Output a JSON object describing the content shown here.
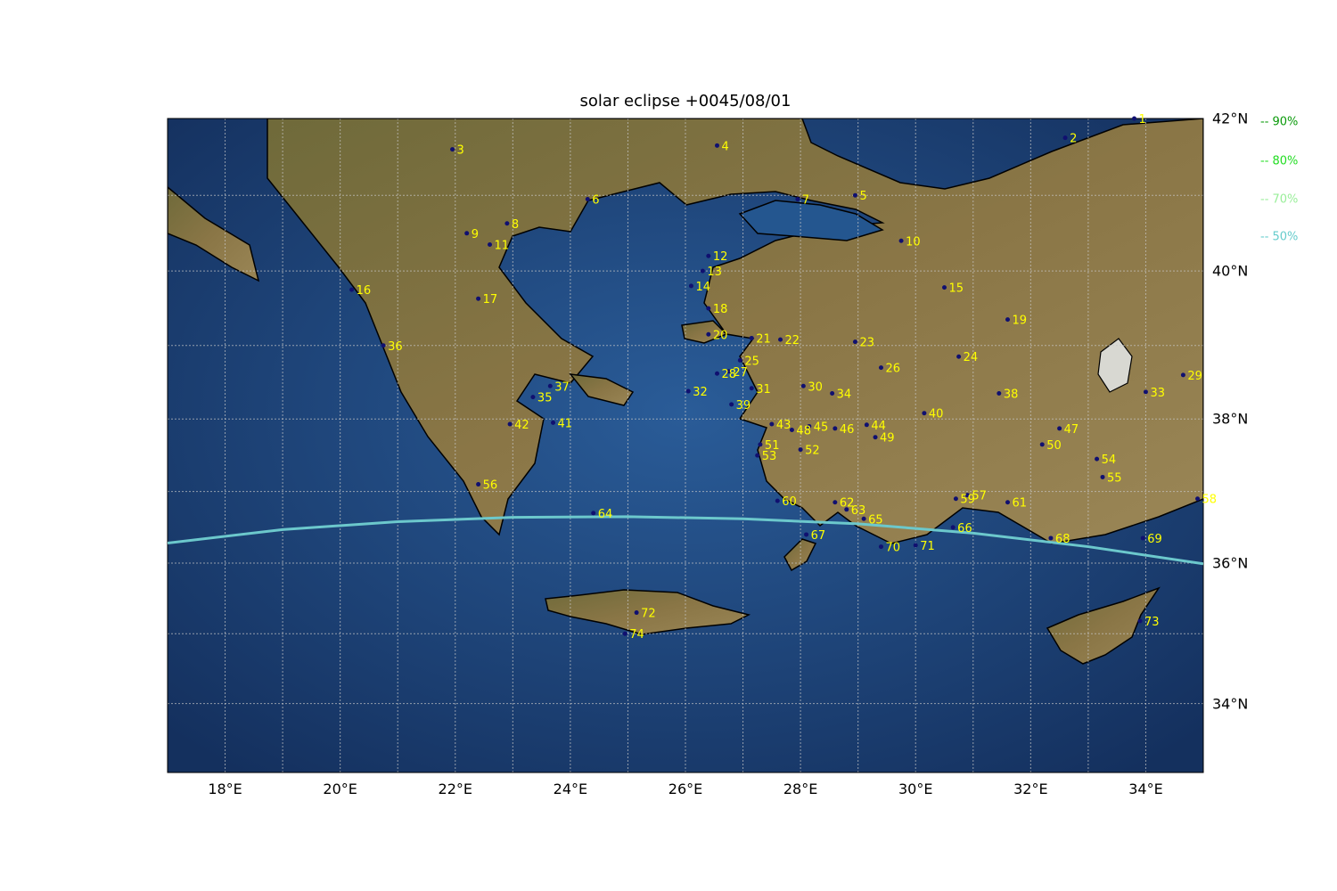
{
  "title": "solar eclipse +0045/08/01",
  "axes": {
    "lon_ticks": [
      "18°E",
      "20°E",
      "22°E",
      "24°E",
      "26°E",
      "28°E",
      "30°E",
      "32°E",
      "34°E"
    ],
    "lat_ticks": [
      "34°N",
      "36°N",
      "38°N",
      "40°N",
      "42°N"
    ]
  },
  "legend": [
    {
      "label": "-- 90%",
      "color": "#0a9a0a"
    },
    {
      "label": "-- 80%",
      "color": "#22dd22"
    },
    {
      "label": "-- 70%",
      "color": "#99ee99"
    },
    {
      "label": "-- 50%",
      "color": "#66cccc"
    }
  ],
  "colors": {
    "curve": "#6cc8cc",
    "marker": "#101070",
    "label": "#ffff00",
    "sea": "#1f4f8a",
    "land": "#7a6a3c"
  },
  "chart_data": {
    "type": "scatter",
    "projection": "plate carree",
    "lon_range": [
      17,
      35
    ],
    "lat_range": [
      33,
      42
    ],
    "grid": true,
    "curves": [
      {
        "name": "50%",
        "points": [
          [
            17,
            36.28
          ],
          [
            19,
            36.47
          ],
          [
            21,
            36.58
          ],
          [
            23,
            36.64
          ],
          [
            25,
            36.65
          ],
          [
            27,
            36.62
          ],
          [
            29,
            36.55
          ],
          [
            31,
            36.42
          ],
          [
            33,
            36.23
          ],
          [
            35,
            35.99
          ]
        ]
      }
    ],
    "cities": [
      {
        "id": "1",
        "lon": 33.8,
        "lat": 42.0
      },
      {
        "id": "2",
        "lon": 32.6,
        "lat": 41.75
      },
      {
        "id": "3",
        "lon": 21.95,
        "lat": 41.6
      },
      {
        "id": "4",
        "lon": 26.55,
        "lat": 41.65
      },
      {
        "id": "5",
        "lon": 28.95,
        "lat": 41.0
      },
      {
        "id": "6",
        "lon": 24.3,
        "lat": 40.95
      },
      {
        "id": "7",
        "lon": 27.95,
        "lat": 40.95
      },
      {
        "id": "8",
        "lon": 22.9,
        "lat": 40.63
      },
      {
        "id": "9",
        "lon": 22.2,
        "lat": 40.5
      },
      {
        "id": "10",
        "lon": 29.75,
        "lat": 40.4
      },
      {
        "id": "11",
        "lon": 22.6,
        "lat": 40.35
      },
      {
        "id": "12",
        "lon": 26.4,
        "lat": 40.2
      },
      {
        "id": "13",
        "lon": 26.3,
        "lat": 40.0
      },
      {
        "id": "14",
        "lon": 26.1,
        "lat": 39.8
      },
      {
        "id": "15",
        "lon": 30.5,
        "lat": 39.78
      },
      {
        "id": "16",
        "lon": 20.2,
        "lat": 39.75
      },
      {
        "id": "17",
        "lon": 22.4,
        "lat": 39.63
      },
      {
        "id": "18",
        "lon": 26.4,
        "lat": 39.5
      },
      {
        "id": "19",
        "lon": 31.6,
        "lat": 39.35
      },
      {
        "id": "20",
        "lon": 26.4,
        "lat": 39.15
      },
      {
        "id": "21",
        "lon": 27.15,
        "lat": 39.1
      },
      {
        "id": "22",
        "lon": 27.65,
        "lat": 39.08
      },
      {
        "id": "23",
        "lon": 28.95,
        "lat": 39.05
      },
      {
        "id": "24",
        "lon": 30.75,
        "lat": 38.85
      },
      {
        "id": "25",
        "lon": 26.95,
        "lat": 38.8
      },
      {
        "id": "26",
        "lon": 29.4,
        "lat": 38.7
      },
      {
        "id": "27",
        "lon": 26.75,
        "lat": 38.65
      },
      {
        "id": "28",
        "lon": 26.55,
        "lat": 38.62
      },
      {
        "id": "29",
        "lon": 34.65,
        "lat": 38.6
      },
      {
        "id": "30",
        "lon": 28.05,
        "lat": 38.45
      },
      {
        "id": "31",
        "lon": 27.15,
        "lat": 38.42
      },
      {
        "id": "32",
        "lon": 26.05,
        "lat": 38.38
      },
      {
        "id": "33",
        "lon": 34.0,
        "lat": 38.37
      },
      {
        "id": "34",
        "lon": 28.55,
        "lat": 38.35
      },
      {
        "id": "35",
        "lon": 23.35,
        "lat": 38.3
      },
      {
        "id": "36",
        "lon": 20.75,
        "lat": 39.0
      },
      {
        "id": "37",
        "lon": 23.65,
        "lat": 38.45
      },
      {
        "id": "38",
        "lon": 31.45,
        "lat": 38.35
      },
      {
        "id": "39",
        "lon": 26.8,
        "lat": 38.2
      },
      {
        "id": "40",
        "lon": 30.15,
        "lat": 38.08
      },
      {
        "id": "41",
        "lon": 23.7,
        "lat": 37.95
      },
      {
        "id": "42",
        "lon": 22.95,
        "lat": 37.93
      },
      {
        "id": "43",
        "lon": 27.5,
        "lat": 37.93
      },
      {
        "id": "44",
        "lon": 29.15,
        "lat": 37.92
      },
      {
        "id": "45",
        "lon": 28.15,
        "lat": 37.9
      },
      {
        "id": "46",
        "lon": 28.6,
        "lat": 37.87
      },
      {
        "id": "47",
        "lon": 32.5,
        "lat": 37.87
      },
      {
        "id": "48",
        "lon": 27.85,
        "lat": 37.85
      },
      {
        "id": "49",
        "lon": 29.3,
        "lat": 37.75
      },
      {
        "id": "50",
        "lon": 32.2,
        "lat": 37.65
      },
      {
        "id": "51",
        "lon": 27.3,
        "lat": 37.65
      },
      {
        "id": "52",
        "lon": 28.0,
        "lat": 37.58
      },
      {
        "id": "53",
        "lon": 27.25,
        "lat": 37.5
      },
      {
        "id": "54",
        "lon": 33.15,
        "lat": 37.45
      },
      {
        "id": "55",
        "lon": 33.25,
        "lat": 37.2
      },
      {
        "id": "56",
        "lon": 22.4,
        "lat": 37.1
      },
      {
        "id": "57",
        "lon": 30.9,
        "lat": 36.95
      },
      {
        "id": "58",
        "lon": 34.9,
        "lat": 36.9
      },
      {
        "id": "59",
        "lon": 30.7,
        "lat": 36.9
      },
      {
        "id": "60",
        "lon": 27.6,
        "lat": 36.87
      },
      {
        "id": "61",
        "lon": 31.6,
        "lat": 36.85
      },
      {
        "id": "62",
        "lon": 28.6,
        "lat": 36.85
      },
      {
        "id": "63",
        "lon": 28.8,
        "lat": 36.75
      },
      {
        "id": "64",
        "lon": 24.4,
        "lat": 36.7
      },
      {
        "id": "65",
        "lon": 29.1,
        "lat": 36.62
      },
      {
        "id": "66",
        "lon": 30.65,
        "lat": 36.5
      },
      {
        "id": "67",
        "lon": 28.1,
        "lat": 36.4
      },
      {
        "id": "68",
        "lon": 32.35,
        "lat": 36.35
      },
      {
        "id": "69",
        "lon": 33.95,
        "lat": 36.35
      },
      {
        "id": "70",
        "lon": 29.4,
        "lat": 36.23
      },
      {
        "id": "71",
        "lon": 30.0,
        "lat": 36.25
      },
      {
        "id": "72",
        "lon": 25.15,
        "lat": 35.3
      },
      {
        "id": "73",
        "lon": 33.9,
        "lat": 35.18
      },
      {
        "id": "74",
        "lon": 24.95,
        "lat": 35.0
      }
    ]
  }
}
